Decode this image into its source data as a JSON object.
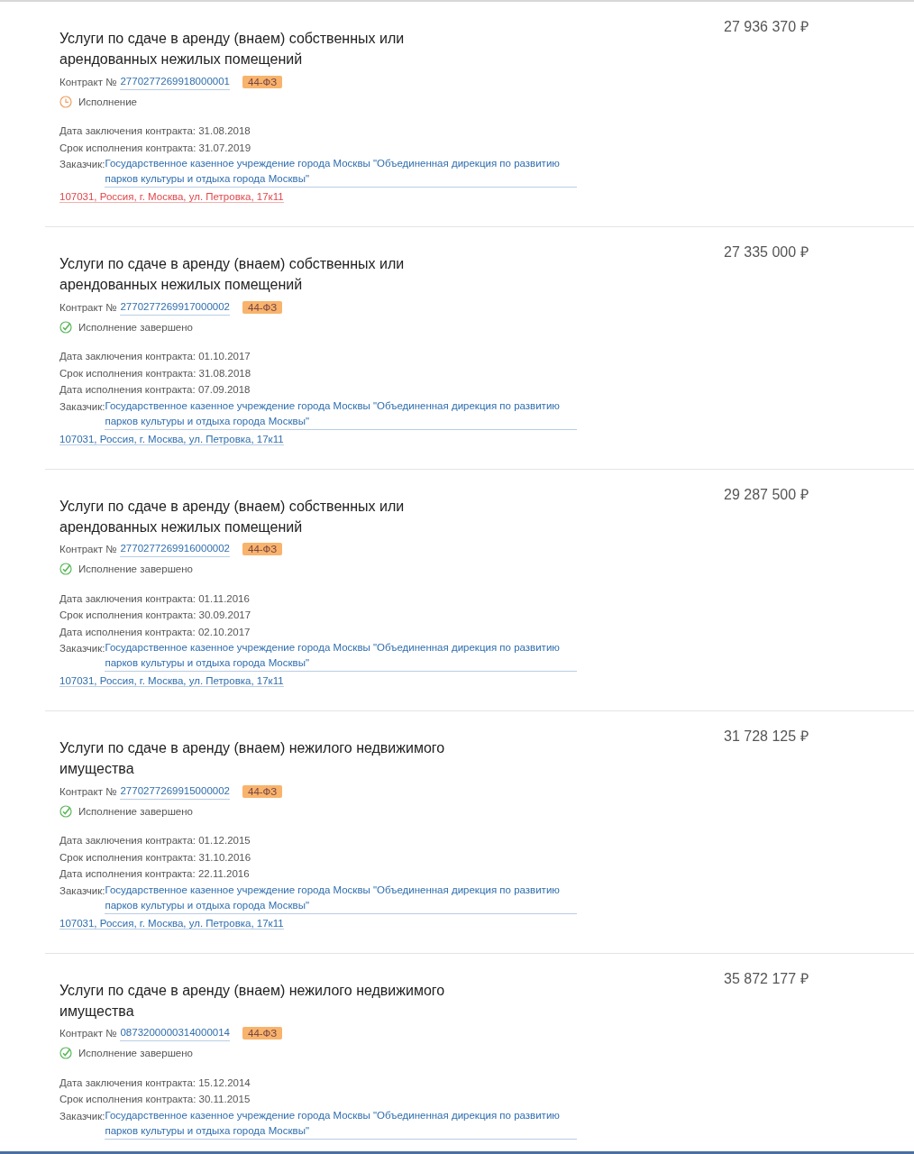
{
  "contracts": [
    {
      "title": "Услуги по сдаче в аренду (внаем) собственных или арендованных нежилых помещений",
      "price": "27 936 370 ₽",
      "contract_label": "Контракт №",
      "contract_number": "2770277269918000001",
      "law": "44-ФЗ",
      "status": {
        "kind": "in_progress",
        "text": "Исполнение"
      },
      "dates": [
        "Дата заключения контракта: 31.08.2018",
        "Срок исполнения контракта: 31.07.2019"
      ],
      "customer_label": "Заказчик:",
      "customer": "Государственное казенное учреждение города Москвы \"Объединенная дирекция по развитию парков культуры и отдыха города Москвы\"",
      "address": "107031, Россия, г. Москва, ул. Петровка, 17к11",
      "address_flagged": true
    },
    {
      "title": "Услуги по сдаче в аренду (внаем) собственных или арендованных нежилых помещений",
      "price": "27 335 000 ₽",
      "contract_label": "Контракт №",
      "contract_number": "2770277269917000002",
      "law": "44-ФЗ",
      "status": {
        "kind": "done",
        "text": "Исполнение завершено"
      },
      "dates": [
        "Дата заключения контракта: 01.10.2017",
        "Срок исполнения контракта: 31.08.2018",
        "Дата исполнения контракта: 07.09.2018"
      ],
      "customer_label": "Заказчик:",
      "customer": "Государственное казенное учреждение города Москвы \"Объединенная дирекция по развитию парков культуры и отдыха города Москвы\"",
      "address": "107031, Россия, г. Москва, ул. Петровка, 17к11",
      "address_flagged": false
    },
    {
      "title": "Услуги по сдаче в аренду (внаем) собственных или арендованных нежилых помещений",
      "price": "29 287 500 ₽",
      "contract_label": "Контракт №",
      "contract_number": "2770277269916000002",
      "law": "44-ФЗ",
      "status": {
        "kind": "done",
        "text": "Исполнение завершено"
      },
      "dates": [
        "Дата заключения контракта: 01.11.2016",
        "Срок исполнения контракта: 30.09.2017",
        "Дата исполнения контракта: 02.10.2017"
      ],
      "customer_label": "Заказчик:",
      "customer": "Государственное казенное учреждение города Москвы \"Объединенная дирекция по развитию парков культуры и отдыха города Москвы\"",
      "address": "107031, Россия, г. Москва, ул. Петровка, 17к11",
      "address_flagged": false
    },
    {
      "title": "Услуги по сдаче в аренду (внаем) нежилого недвижимого имущества",
      "price": "31 728 125 ₽",
      "contract_label": "Контракт №",
      "contract_number": "2770277269915000002",
      "law": "44-ФЗ",
      "status": {
        "kind": "done",
        "text": "Исполнение завершено"
      },
      "dates": [
        "Дата заключения контракта: 01.12.2015",
        "Срок исполнения контракта: 31.10.2016",
        "Дата исполнения контракта: 22.11.2016"
      ],
      "customer_label": "Заказчик:",
      "customer": "Государственное казенное учреждение города Москвы \"Объединенная дирекция по развитию парков культуры и отдыха города Москвы\"",
      "address": "107031, Россия, г. Москва, ул. Петровка, 17к11",
      "address_flagged": false
    },
    {
      "title": "Услуги по сдаче в аренду (внаем) нежилого недвижимого имущества",
      "price": "35 872 177 ₽",
      "contract_label": "Контракт №",
      "contract_number": "0873200000314000014",
      "law": "44-ФЗ",
      "status": {
        "kind": "done",
        "text": "Исполнение завершено"
      },
      "dates": [
        "Дата заключения контракта: 15.12.2014",
        "Срок исполнения контракта: 30.11.2015"
      ],
      "customer_label": "Заказчик:",
      "customer": "Государственное казенное учреждение города Москвы \"Объединенная дирекция по развитию парков культуры и отдыха города Москвы\""
    }
  ]
}
